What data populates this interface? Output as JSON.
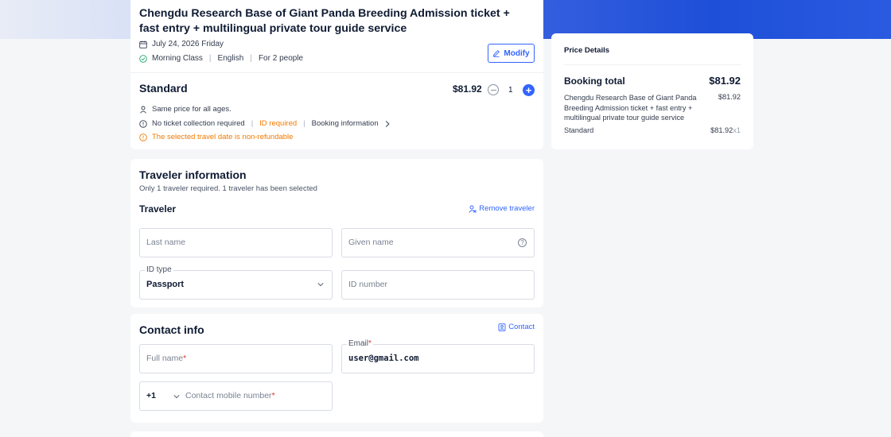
{
  "product": {
    "title": "Chengdu Research Base of Giant Panda Breeding Admission ticket + fast entry + multilingual private tour guide service",
    "date": "July 24, 2026 Friday",
    "options": [
      "Morning Class",
      "English",
      "For 2 people"
    ],
    "modify_label": "Modify"
  },
  "package": {
    "name": "Standard",
    "price": "$81.92",
    "quantity": "1",
    "same_price": "Same price for all ages.",
    "no_collection": "No ticket collection required",
    "id_required": "ID required",
    "booking_info": "Booking information",
    "non_refundable": "The selected travel date is non-refundable"
  },
  "traveler": {
    "section_title": "Traveler information",
    "subtitle": "Only 1 traveler required. 1 traveler has been selected",
    "label": "Traveler",
    "remove_label": "Remove traveler",
    "last_name_ph": "Last name",
    "given_name_ph": "Given name",
    "id_type_label": "ID type",
    "id_type_value": "Passport",
    "id_number_ph": "ID number"
  },
  "contact": {
    "section_title": "Contact info",
    "contact_link": "Contact",
    "full_name_ph": "Full name",
    "email_label": "Email",
    "email_value": "user@gmail.com",
    "country_code": "+1",
    "mobile_ph": "Contact mobile number",
    "required_mark": "*"
  },
  "price_details": {
    "title": "Price Details",
    "total_label": "Booking total",
    "total_value": "$81.92",
    "item_name": "Chengdu Research Base of Giant Panda Breeding Admission ticket + fast entry + multilingual private tour guide service",
    "item_price": "$81.92",
    "package_label": "Standard",
    "package_price": "$81.92",
    "package_mult": "x1"
  },
  "colors": {
    "accent": "#3264ff",
    "warning": "#f07a00",
    "required": "#e0342b"
  }
}
